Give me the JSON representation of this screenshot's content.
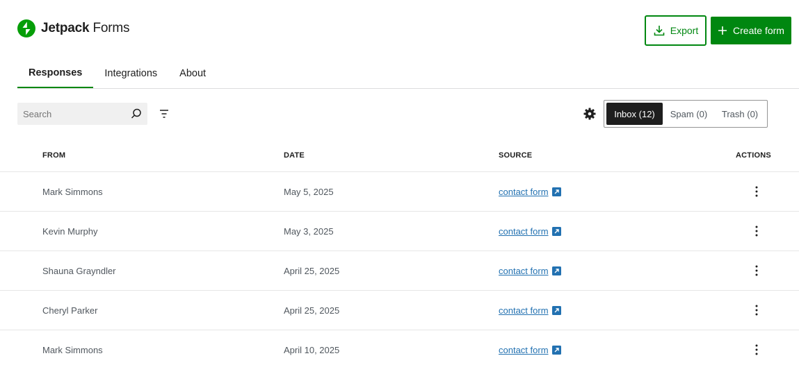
{
  "app": {
    "name_bold": "Jetpack",
    "name_rest": " Forms"
  },
  "header": {
    "export_label": "Export",
    "create_label": "Create form"
  },
  "tabs": [
    {
      "label": "Responses",
      "active": true
    },
    {
      "label": "Integrations",
      "active": false
    },
    {
      "label": "About",
      "active": false
    }
  ],
  "toolbar": {
    "search_placeholder": "Search",
    "folders": [
      {
        "label": "Inbox (12)",
        "active": true
      },
      {
        "label": "Spam (0)",
        "active": false
      },
      {
        "label": "Trash (0)",
        "active": false
      }
    ]
  },
  "table": {
    "headers": {
      "from": "FROM",
      "date": "DATE",
      "source": "SOURCE",
      "actions": "ACTIONS"
    },
    "rows": [
      {
        "from": "Mark Simmons",
        "date": "May 5, 2025",
        "source": "contact form"
      },
      {
        "from": "Kevin Murphy",
        "date": "May 3, 2025",
        "source": "contact form"
      },
      {
        "from": "Shauna Grayndler",
        "date": "April 25, 2025",
        "source": "contact form"
      },
      {
        "from": "Cheryl Parker",
        "date": "April 25, 2025",
        "source": "contact form"
      },
      {
        "from": "Mark Simmons",
        "date": "April 10, 2025",
        "source": "contact form"
      }
    ]
  },
  "colors": {
    "brand": "#069e08",
    "primary": "#008710",
    "link": "#2271b1",
    "active_segment": "#1e1e1e"
  },
  "icons": {
    "logo": "jetpack-bolt-icon",
    "export": "download-icon",
    "create": "plus-icon",
    "search": "search-icon",
    "filter": "filter-icon",
    "settings": "gear-icon",
    "external": "external-link-icon",
    "actions": "more-vertical-icon"
  }
}
